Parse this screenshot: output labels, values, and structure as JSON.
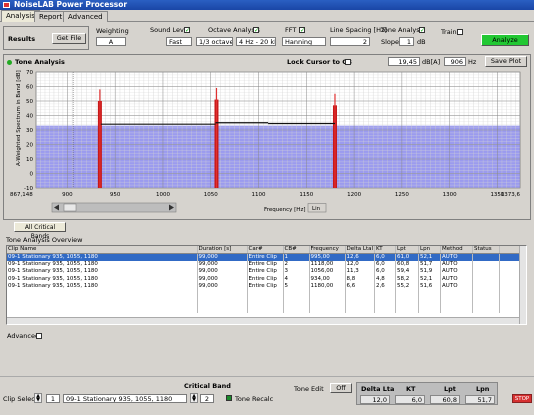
{
  "app": {
    "title": "NoiseLAB Power Processor"
  },
  "tabs": [
    {
      "label": "Analysis"
    },
    {
      "label": "Report"
    },
    {
      "label": "Advanced"
    }
  ],
  "toolbar": {
    "results_label": "Results",
    "get_file_label": "Get File",
    "weighting_label": "Weighting",
    "weighting_value": "A",
    "sound_level_label": "Sound Level",
    "sound_level_value": "Fast",
    "octave_label": "Octave Analysis",
    "octave_value": "1/3 octave",
    "freq_range_value": "4 Hz - 20 kHz",
    "fft_label": "FFT",
    "fft_window_value": "Hanning",
    "line_spacing_label": "Line Spacing [Hz]",
    "line_spacing_value": "2",
    "tone_analysis_label": "Tone Analysis",
    "slope_label": "Slope",
    "slope_value": "1",
    "slope_unit": "dB",
    "train_label": "Train",
    "analyze_label": "Analyze",
    "analyze_color": "#22c833"
  },
  "panel": {
    "title": "Tone Analysis",
    "lock_cursor_label": "Lock Cursor to CB",
    "cursor_db_value": "19,45",
    "cursor_db_unit": "dB[A]",
    "cursor_hz_value": "906",
    "cursor_hz_unit": "Hz",
    "save_plot_label": "Save Plot",
    "all_critical_bands_label": "All Critical Bands",
    "lin_label": "Lin"
  },
  "chart_data": {
    "type": "bar",
    "ylabel": "A-Weighted Spectrum in Band [dB]",
    "xlabel": "Frequency [Hz]",
    "xlim": [
      867.148,
      1373.6
    ],
    "ylim": [
      -10,
      70
    ],
    "x_tick_labels": [
      "867,148",
      "900",
      "950",
      "1000",
      "1050",
      "1100",
      "1150",
      "1200",
      "1250",
      "1300",
      "1350",
      "1373,6"
    ],
    "x_tick_values": [
      867.148,
      900,
      950,
      1000,
      1050,
      1100,
      1150,
      1200,
      1250,
      1300,
      1350,
      1373.6
    ],
    "y_tick_values": [
      -10,
      0,
      10,
      20,
      30,
      40,
      50,
      60,
      70
    ],
    "noise_floor_db": 33,
    "grid": true,
    "background_color": "#ffffff",
    "noise_color": "#9b9bef",
    "tone_color": "#c81818",
    "tones": [
      {
        "freq": 934,
        "level": 58
      },
      {
        "freq": 1056,
        "level": 59
      },
      {
        "freq": 1180,
        "level": 55
      }
    ],
    "critical_band_lines": [
      {
        "x1": 935,
        "x2": 1055,
        "y": 34
      },
      {
        "x1": 1055,
        "x2": 1110,
        "y": 35
      },
      {
        "x1": 1110,
        "x2": 1180,
        "y": 34.5
      }
    ]
  },
  "overview": {
    "title": "Tone Analysis Overview",
    "columns": [
      "Clip Name",
      "Duration [s]",
      "Car#",
      "CB#",
      "Frequency",
      "Delta Ltal",
      "KT",
      "Lpt",
      "Lpn",
      "Method",
      "Status"
    ],
    "rows": [
      [
        "09-1 Stationary 935, 1055, 1180",
        "99,000",
        "Entire Clip",
        "1",
        "995,00",
        "12,6",
        "6,0",
        "61,0",
        "52,1",
        "AUTO",
        ""
      ],
      [
        "09-1 Stationary 935, 1055, 1180",
        "99,000",
        "Entire Clip",
        "2",
        "1118,00",
        "12,0",
        "6,0",
        "60,8",
        "51,7",
        "AUTO",
        ""
      ],
      [
        "09-1 Stationary 935, 1055, 1180",
        "99,000",
        "Entire Clip",
        "3",
        "1056,00",
        "11,3",
        "6,0",
        "59,4",
        "51,9",
        "AUTO",
        ""
      ],
      [
        "09-1 Stationary 935, 1055, 1180",
        "99,000",
        "Entire Clip",
        "4",
        "934,00",
        "8,8",
        "4,8",
        "58,2",
        "52,1",
        "AUTO",
        ""
      ],
      [
        "09-1 Stationary 935, 1055, 1180",
        "99,000",
        "Entire Clip",
        "5",
        "1180,00",
        "6,6",
        "2,6",
        "55,2",
        "51,6",
        "AUTO",
        ""
      ]
    ],
    "advanced_label": "Advanced"
  },
  "bottom": {
    "clip_select_label": "Clip Select",
    "clip_index": "1",
    "clip_name": "09-1 Stationary 935, 1055, 1180",
    "critical_band_label": "Critical Band",
    "critical_band_value": "2",
    "tone_recalc_label": "Tone Recalc",
    "tone_edit_label": "Tone Edit",
    "tone_edit_value": "Off",
    "results_headers": [
      "Delta Lta",
      "KT",
      "Lpt",
      "Lpn"
    ],
    "results_values": [
      "12,0",
      "6,0",
      "60,8",
      "51,7"
    ],
    "stop_label": "STOP"
  }
}
